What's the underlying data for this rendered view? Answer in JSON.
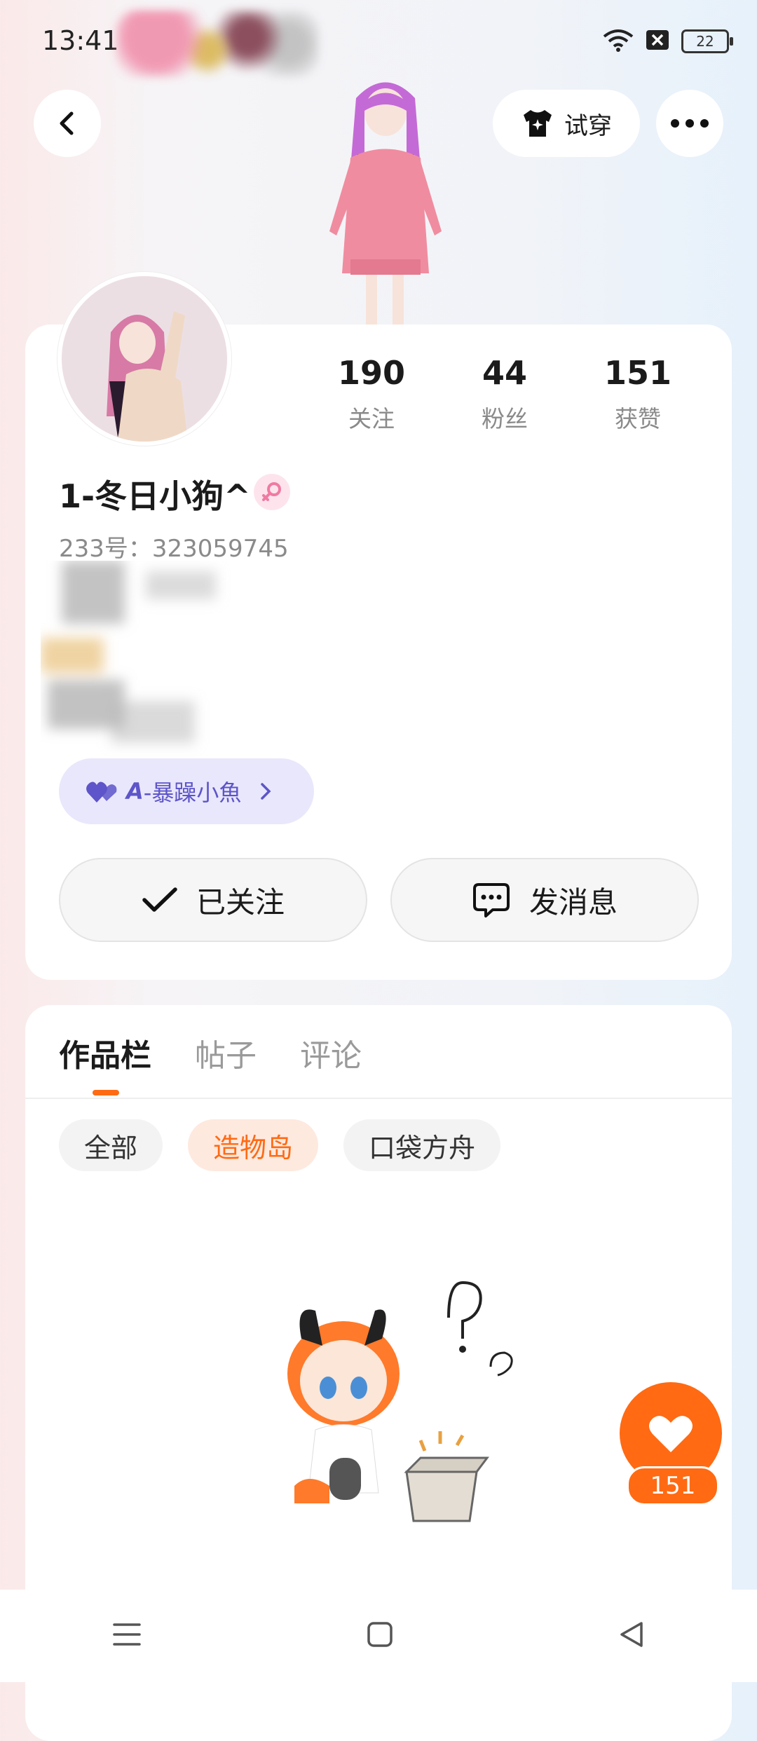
{
  "status_bar": {
    "time": "13:41",
    "battery": "22",
    "icons": [
      "wifi-icon",
      "sim-disabled-icon",
      "battery-icon"
    ]
  },
  "header": {
    "back_icon": "chevron-left-icon",
    "try_on_label": "试穿",
    "try_on_icon": "shirt-icon",
    "more_icon": "ellipsis-icon"
  },
  "profile": {
    "name": "1-冬日小狗^",
    "gender_icon": "female-icon",
    "uid": "233号：323059745",
    "stats": [
      {
        "value": "190",
        "label": "关注"
      },
      {
        "value": "44",
        "label": "粉丝"
      },
      {
        "value": "151",
        "label": "获赞"
      }
    ],
    "badge": {
      "icon": "heart-pair-icon",
      "prefix": "A",
      "text": "-暴躁小魚",
      "chevron_icon": "chevron-right-icon"
    },
    "follow_button": {
      "label": "已关注",
      "icon": "check-icon"
    },
    "message_button": {
      "label": "发消息",
      "icon": "chat-bubble-icon"
    }
  },
  "works": {
    "tabs": [
      {
        "label": "作品栏",
        "active": true
      },
      {
        "label": "帖子",
        "active": false
      },
      {
        "label": "评论",
        "active": false
      }
    ],
    "filters": [
      {
        "label": "全部",
        "selected": false
      },
      {
        "label": "造物岛",
        "selected": true
      },
      {
        "label": "口袋方舟",
        "selected": false
      }
    ]
  },
  "like_fab": {
    "icon": "heart-icon",
    "count": "151"
  },
  "colors": {
    "accent": "#ff6a13",
    "badge_bg": "#e9e7fb",
    "badge_text": "#5d55c9"
  },
  "navbar": {
    "icons": [
      "menu-icon",
      "home-square-icon",
      "back-triangle-icon"
    ]
  }
}
